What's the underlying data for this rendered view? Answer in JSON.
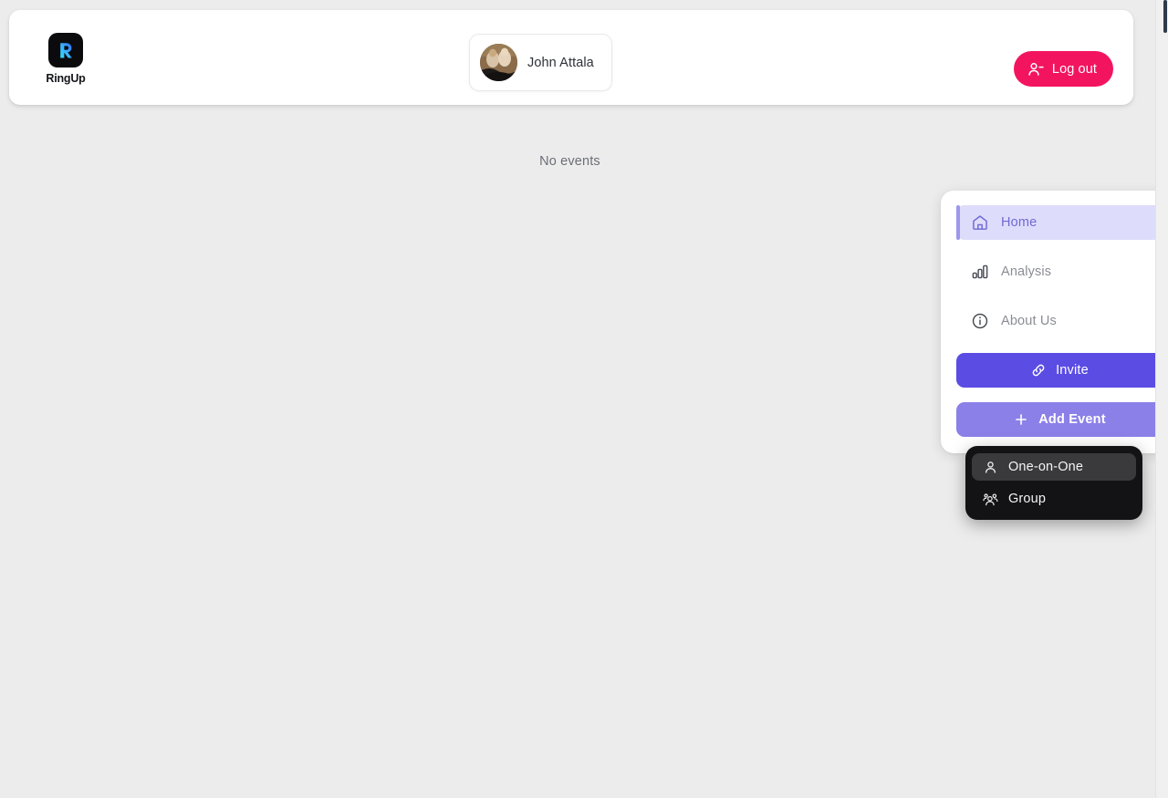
{
  "app": {
    "brand_name": "RingUp",
    "brand_icon": "ringup-logo-icon",
    "accent_purple": "#5b4ce4",
    "accent_purple_light": "#8b80e8",
    "accent_pink": "#f3145f",
    "active_nav_bg": "#dedcfb",
    "page_bg": "#ececec"
  },
  "header": {
    "user": {
      "name": "John Attala",
      "avatar_icon": "user-avatar-photo"
    },
    "logout": {
      "label": "Log out",
      "icon": "user-minus-icon"
    }
  },
  "main": {
    "empty_state_text": "No events"
  },
  "sidebar": {
    "items": [
      {
        "label": "Home",
        "icon": "home-icon",
        "active": true
      },
      {
        "label": "Analysis",
        "icon": "bar-chart-icon",
        "active": false
      },
      {
        "label": "About Us",
        "icon": "info-circle-icon",
        "active": false
      }
    ],
    "invite_button": {
      "label": "Invite",
      "icon": "link-chain-icon"
    },
    "add_event_button": {
      "label": "Add Event",
      "icon": "plus-icon"
    }
  },
  "add_event_menu": {
    "items": [
      {
        "label": "One-on-One",
        "icon": "single-person-icon",
        "highlighted": true
      },
      {
        "label": "Group",
        "icon": "group-people-icon",
        "highlighted": false
      }
    ]
  },
  "scrollbar": {
    "thumb_color": "#2e3a4b"
  }
}
